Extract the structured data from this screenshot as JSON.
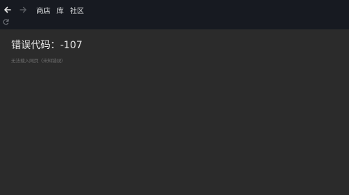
{
  "navbar": {
    "back_icon": "arrow-left-icon",
    "forward_icon": "arrow-right-icon",
    "reload_icon": "reload-icon",
    "links": [
      {
        "label": "商店"
      },
      {
        "label": "库"
      },
      {
        "label": "社区"
      }
    ]
  },
  "error": {
    "title": "错误代码：-107",
    "description": "无法载入网页（未知错误）"
  },
  "colors": {
    "navbar_bg": "#171a21",
    "content_bg": "#2b2b2b",
    "title_text": "#e6e6e6",
    "desc_text": "#6e6e6e"
  }
}
